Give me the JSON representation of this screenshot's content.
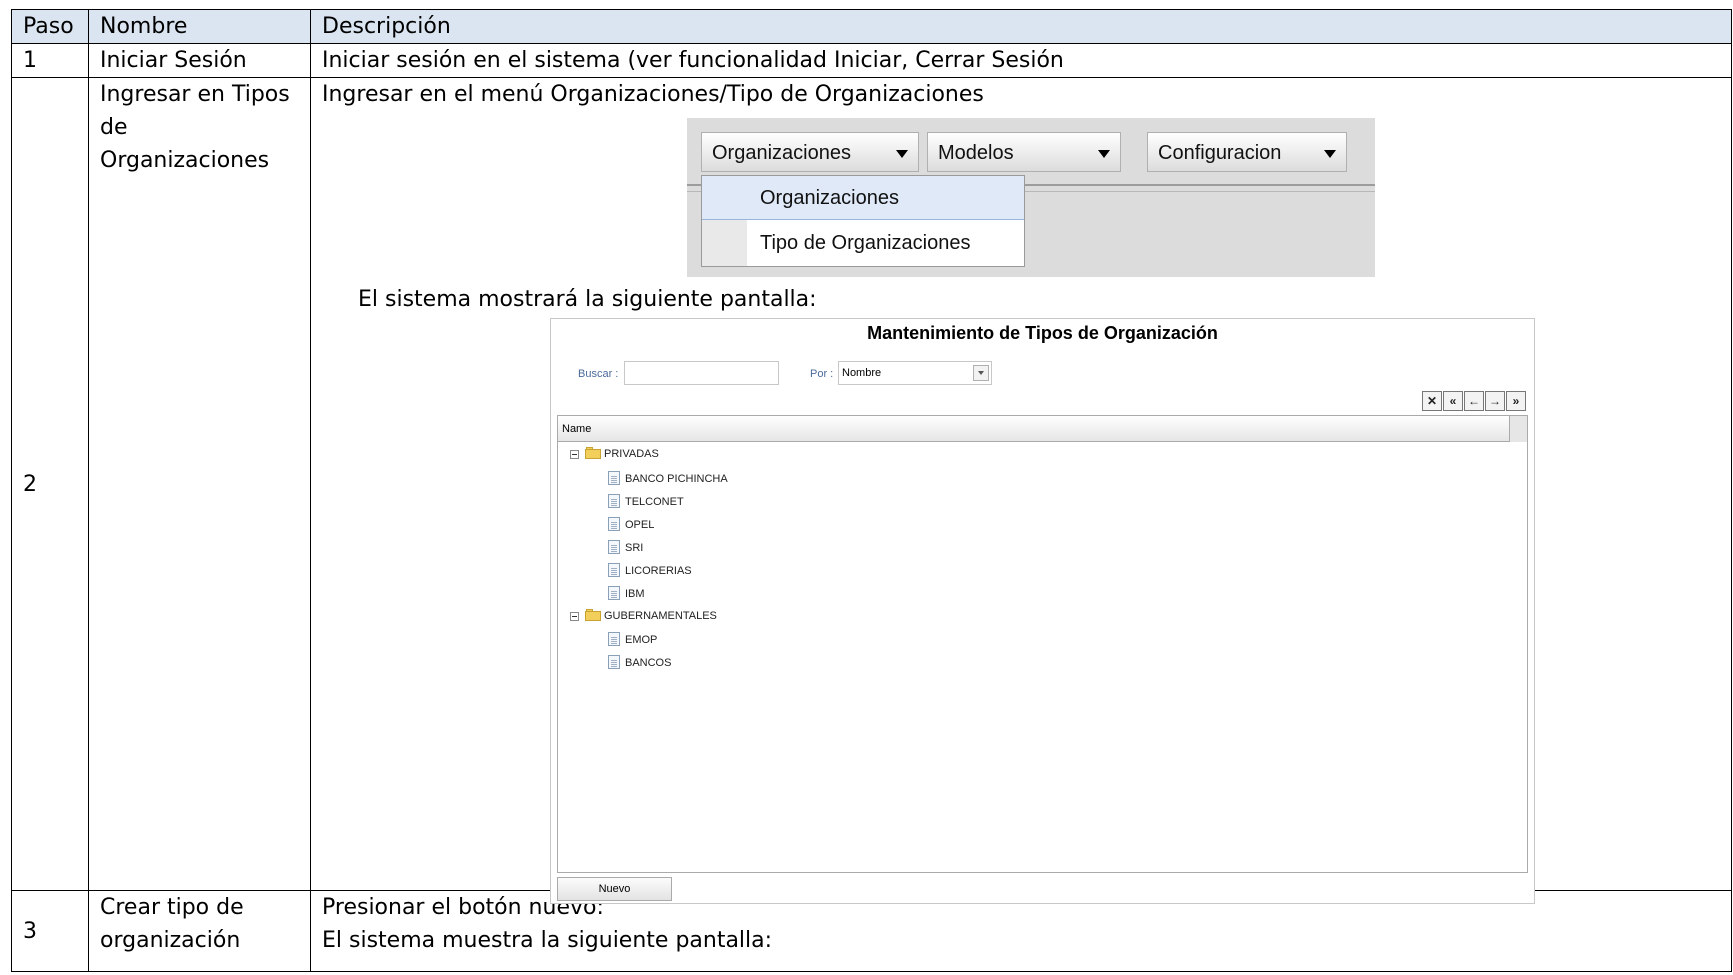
{
  "table": {
    "headers": {
      "paso": "Paso",
      "nombre": "Nombre",
      "descripcion": "Descripción"
    },
    "rows": [
      {
        "paso": "1",
        "nombre": "Iniciar Sesión",
        "descripcion": "Iniciar sesión en el sistema (ver funcionalidad Iniciar, Cerrar Sesión"
      },
      {
        "paso": "2",
        "nombre_lines": [
          "Ingresar en Tipos",
          "de",
          "Organizaciones"
        ],
        "descripcion": "Ingresar en el menú Organizaciones/Tipo de Organizaciones",
        "descripcion2": "El sistema mostrará la siguiente pantalla:"
      },
      {
        "paso": "3",
        "nombre_lines": [
          "Crear tipo de",
          "organización"
        ],
        "descripcion_lines": [
          "Presionar el botón nuevo:",
          "El sistema muestra la siguiente pantalla:"
        ]
      }
    ]
  },
  "menu_screenshot": {
    "menus": [
      {
        "label": "Organizaciones"
      },
      {
        "label": "Modelos"
      },
      {
        "label": "Configuracion"
      }
    ],
    "dropdown_items": [
      {
        "label": "Organizaciones",
        "highlighted": true
      },
      {
        "label": "Tipo de Organizaciones",
        "highlighted": false
      }
    ]
  },
  "screen_screenshot": {
    "title": "Mantenimiento de Tipos de Organización",
    "search_label": "Buscar :",
    "search_value": "",
    "by_label": "Por :",
    "by_value": "Nombre",
    "nav_buttons": [
      {
        "glyph": "✕",
        "icon": "close-icon"
      },
      {
        "glyph": "«",
        "icon": "first-page-icon"
      },
      {
        "glyph": "←",
        "icon": "previous-page-icon"
      },
      {
        "glyph": "→",
        "icon": "next-page-icon"
      },
      {
        "glyph": "»",
        "icon": "last-page-icon"
      }
    ],
    "grid_header": "Name",
    "tree": [
      {
        "label": "PRIVADAS",
        "type": "folder",
        "children": [
          "BANCO PICHINCHA",
          "TELCONET",
          "OPEL",
          "SRI",
          "LICORERIAS",
          "IBM"
        ]
      },
      {
        "label": "GUBERNAMENTALES",
        "type": "folder",
        "children": [
          "EMOP",
          "BANCOS"
        ]
      }
    ],
    "new_button": "Nuevo"
  }
}
